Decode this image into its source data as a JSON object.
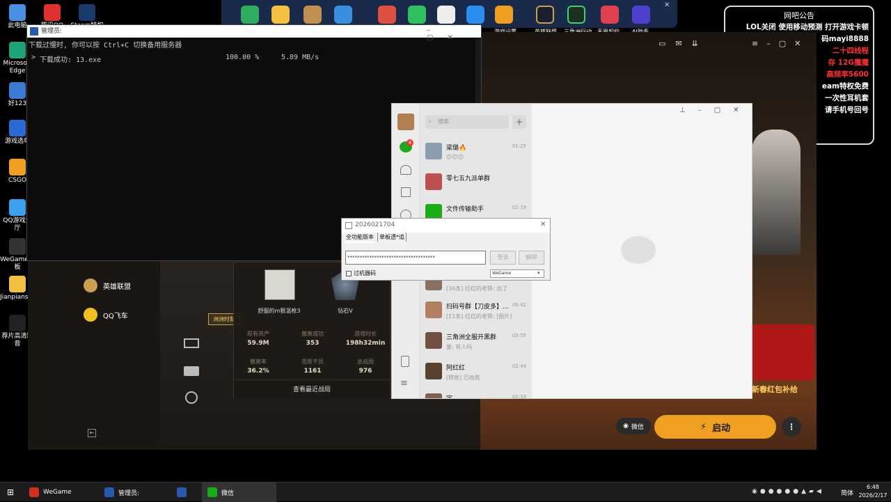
{
  "desktop": {
    "icons": [
      {
        "label": "此电脑",
        "color": "#4a90e2"
      },
      {
        "label": "Microsoft Edge",
        "color": "#1fa37a"
      },
      {
        "label": "好123",
        "color": "#3a7bd5"
      },
      {
        "label": "游戏选单",
        "color": "#2a6ad5"
      },
      {
        "label": "CSGO",
        "color": "#f0a020"
      },
      {
        "label": "QQ游戏大厅",
        "color": "#3aa0f0"
      },
      {
        "label": "WeGame吧板",
        "color": "#333333"
      },
      {
        "label": "Jianpianse...",
        "color": "#f0c040"
      },
      {
        "label": "荐片高清影音",
        "color": "#222222"
      }
    ],
    "row2": [
      {
        "label": "腾讯QQ"
      },
      {
        "label": "Steam特权免"
      }
    ]
  },
  "dock": {
    "labels": [
      "游戏设置",
      "英雄联盟",
      "三角洲行动",
      "无畏契约",
      "AI助手"
    ]
  },
  "notice": {
    "title": "网吧公告",
    "lines": [
      "LOL关闭 使用移动预测 打开游戏卡顿",
      "码mayi8888",
      "二十四线程",
      "存 12G魔魔",
      "高频率5600",
      "eam特权免费",
      "一次性耳机套",
      "请手机号回号"
    ]
  },
  "cmd": {
    "title": "管理员:",
    "line1": "下载过慢时, 你可以按 Ctrl+C 切换备用服务器",
    "line2_prefix": ">",
    "line2_file": "下载成功: 13.exe",
    "line2_pct": "100.00 %",
    "line2_speed": "5.89 MB/s"
  },
  "wegame": {
    "nav": [
      {
        "label": "英雄联盟"
      },
      {
        "label": "QQ飞车"
      }
    ],
    "tag": "洲洲时刻",
    "player": {
      "name": "舒服的m狠温枪3",
      "rank": "钻石V"
    },
    "stats": [
      {
        "label": "现有资产",
        "value": "59.9M"
      },
      {
        "label": "撤离成功",
        "value": "353"
      },
      {
        "label": "游戏时长",
        "value": "198h32min"
      },
      {
        "label": "撤离率",
        "value": "36.2%"
      },
      {
        "label": "击败干员",
        "value": "1161"
      },
      {
        "label": "总战局",
        "value": "976"
      }
    ],
    "recent": "查看最近战局",
    "wechat_btn": "微信",
    "launch": "启动",
    "more": "⋮",
    "redpack": "新春红包补给"
  },
  "wechat": {
    "search_placeholder": "搜索",
    "badge": "4",
    "chats": [
      {
        "name": "梁璐🔥",
        "msg": "😊😊😊",
        "time": "01:25",
        "color": "#8a9cb0"
      },
      {
        "name": "零七五九派单群",
        "msg": "",
        "time": "",
        "color": "#c05050"
      },
      {
        "name": "文件传输助手",
        "msg": "",
        "time": "02:19",
        "color": "#1aad19"
      },
      {
        "name": "",
        "msg": "[36条] 红红的老铁: 出了",
        "time": "",
        "color": "#8a7060"
      },
      {
        "name": "扫码号群【刀皮多】...",
        "msg": "[11条] 红红的老铁: [图片]",
        "time": "06:42",
        "color": "#b08060"
      },
      {
        "name": "三角洲全服开黑群",
        "msg": "量: 有人吗",
        "time": "03:55",
        "color": "#705040"
      },
      {
        "name": "阿红红",
        "msg": "[转账] 已收款",
        "time": "02:44",
        "color": "#5a4030"
      },
      {
        "name": "宇",
        "msg": "",
        "time": "02:33",
        "color": "#806050"
      }
    ]
  },
  "dialog": {
    "title": "2026021704",
    "tab1": "全功能版本",
    "tab2": "单板透*追",
    "password": "************************************",
    "login": "登录",
    "unbind": "解绑",
    "checkbox": "过机器码",
    "select": "WeGame"
  },
  "taskbar": {
    "items": [
      {
        "label": "WeGame",
        "color": "#d03020"
      },
      {
        "label": "管理员:",
        "color": "#2a5ab0"
      },
      {
        "label": "",
        "color": "#2a5ab0"
      },
      {
        "label": "微信",
        "color": "#1aad19"
      }
    ],
    "lang": "简体",
    "time": "6:48",
    "date": "2026/2/17"
  }
}
